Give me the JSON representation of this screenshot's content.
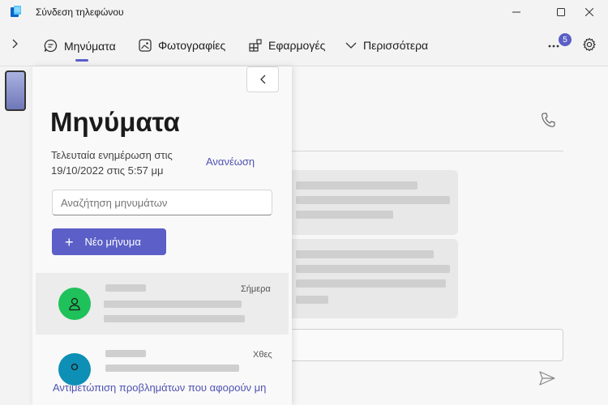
{
  "app": {
    "title": "Σύνδεση τηλεφώνου",
    "icon": "phone-link-logo-icon"
  },
  "window_controls": [
    "minimize-icon",
    "maximize-icon",
    "close-icon"
  ],
  "nav": {
    "tabs": [
      {
        "label": "Μηνύματα",
        "icon": "chat-icon",
        "selected": true
      },
      {
        "label": "Φωτογραφίες",
        "icon": "photos-icon",
        "selected": false
      },
      {
        "label": "Εφαρμογές",
        "icon": "apps-icon",
        "selected": false
      },
      {
        "label": "Περισσότερα",
        "icon": "chevron-down-icon",
        "selected": false
      }
    ],
    "notification_count": "5",
    "accent": "#5b5fc7"
  },
  "messages_panel": {
    "title": "Μηνύματα",
    "updated_text": "Τελευταία ενημέρωση στις 19/10/2022 στις 5:57 μμ",
    "refresh_label": "Ανανέωση",
    "search_placeholder": "Αναζήτηση μηνυμάτων",
    "new_message_label": "Νέο μήνυμα",
    "conversations": [
      {
        "date": "Σήμερα",
        "avatar_color": "#1fc15a",
        "selected": true
      },
      {
        "date": "Χθες",
        "avatar_color": "#0e8fb5",
        "selected": false
      }
    ],
    "troubleshoot_link": "Αντιμετώπιση προβλημάτων που αφορούν μη"
  },
  "conversation_view": {
    "call_icon": "phone-icon",
    "send_icon": "send-icon"
  }
}
